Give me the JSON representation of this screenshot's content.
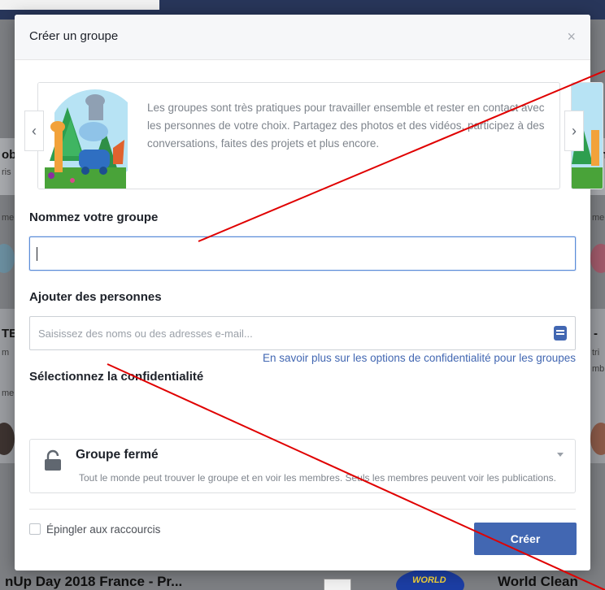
{
  "background": {
    "left_fragments": [
      "ob",
      "ris",
      "me",
      "TE",
      "m",
      "me"
    ],
    "right_fragments": [
      "Sm",
      "as",
      "me",
      "-",
      "tri",
      "mb"
    ],
    "footer_left": "nUp Day 2018 France - Pr...",
    "footer_right": "World Clean",
    "footer_logo": "WORLD"
  },
  "modal": {
    "title": "Créer un groupe",
    "close_label": "×"
  },
  "carousel": {
    "prev_label": "‹",
    "next_label": "›",
    "card_text": "Les groupes sont très pratiques pour travailler ensemble et rester en contact avec les personnes de votre choix. Partagez des photos et des vidéos, participez à des conversations, faites des projets et plus encore."
  },
  "name_section": {
    "label": "Nommez votre groupe",
    "value": ""
  },
  "people_section": {
    "label": "Ajouter des personnes",
    "placeholder": "Saisissez des noms ou des adresses e-mail..."
  },
  "privacy_section": {
    "label": "Sélectionnez la confidentialité",
    "link": "En savoir plus sur les options de confidentialité pour les groupes",
    "selected_title": "Groupe fermé",
    "selected_desc": "Tout le monde peut trouver le groupe et en voir les membres. Seuls les membres peuvent voir les publications."
  },
  "footer": {
    "pin_label": "Épingler aux raccourcis",
    "create_label": "Créer"
  },
  "colors": {
    "accent": "#4267b2",
    "annotation_line": "#e00000"
  }
}
